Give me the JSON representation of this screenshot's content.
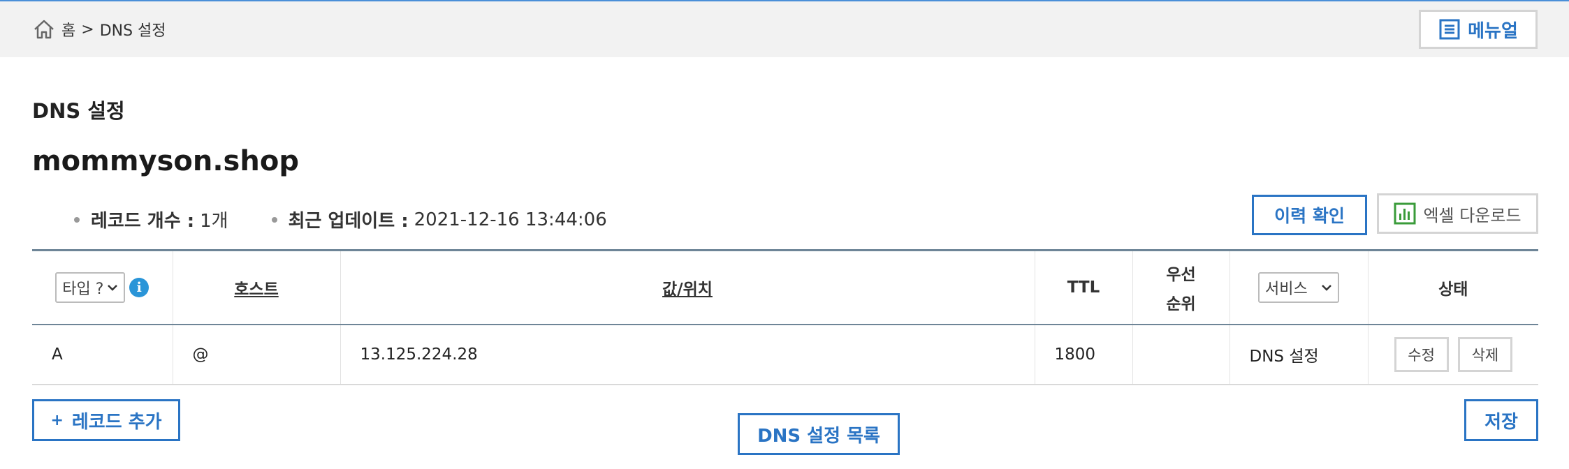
{
  "breadcrumb": {
    "home": "홈",
    "separator": ">",
    "current": "DNS 설정"
  },
  "header": {
    "manual_label": "메뉴얼"
  },
  "page": {
    "section_title": "DNS 설정",
    "domain": "mommyson.shop"
  },
  "meta": {
    "record_count_label": "레코드 개수 :",
    "record_count_value": "1개",
    "last_update_label": "최근 업데이트 :",
    "last_update_value": "2021-12-16 13:44:06"
  },
  "actions": {
    "history_label": "이력 확인",
    "excel_label": "엑셀 다운로드"
  },
  "table": {
    "headers": {
      "type_select": "타입 ?",
      "host": "호스트",
      "value": "값/위치",
      "ttl": "TTL",
      "priority_line1": "우선",
      "priority_line2": "순위",
      "service_select": "서비스",
      "status": "상태"
    },
    "rows": [
      {
        "type": "A",
        "host": "@",
        "value": "13.125.224.28",
        "ttl": "1800",
        "priority": "",
        "service": "DNS 설정",
        "edit_label": "수정",
        "delete_label": "삭제"
      }
    ]
  },
  "footer": {
    "add_record_label": "레코드 추가",
    "dns_list_label": "DNS 설정 목록",
    "save_label": "저장"
  },
  "colors": {
    "accent": "#2a74c4",
    "table_border": "#6e8597",
    "topbar": "#f2f2f2",
    "excel_green": "#3a9b3a"
  },
  "icons": {
    "home": "home-icon",
    "manual": "document-list-icon",
    "excel": "bar-chart-icon",
    "info": "info-icon",
    "chevron": "chevron-down-icon"
  }
}
